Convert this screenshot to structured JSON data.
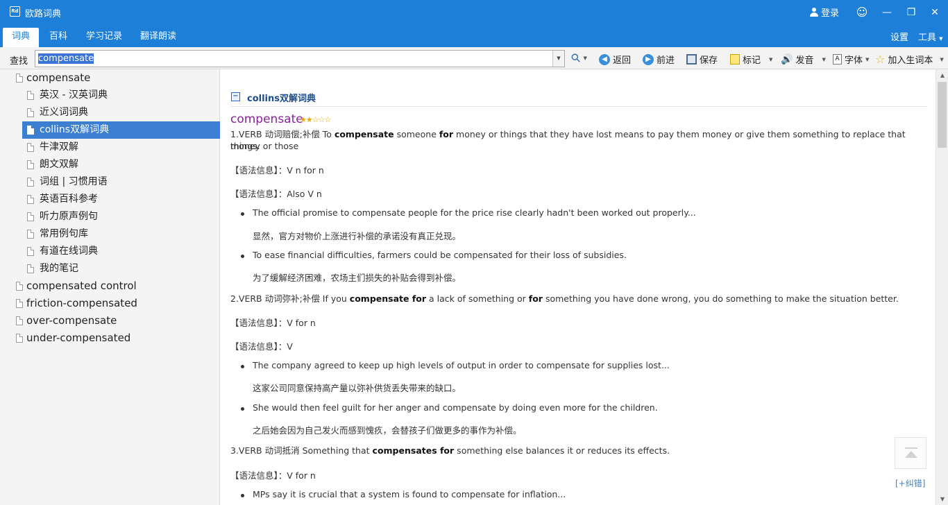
{
  "titlebar": {
    "logo_text": "Rd",
    "app_title": "欧路词典",
    "login": "登录",
    "smile_icon": "☺",
    "minimize": "—",
    "restore": "❐",
    "close": "✕"
  },
  "tabs": [
    {
      "label": "词典"
    },
    {
      "label": "百科"
    },
    {
      "label": "学习记录"
    },
    {
      "label": "翻译朗读"
    }
  ],
  "tabbar_right": {
    "settings": "设置",
    "tools": "工具"
  },
  "toolbar": {
    "search_label": "查找",
    "search_value": "compensate",
    "search_icon": "⚲",
    "back": "返回",
    "forward": "前进",
    "save": "保存",
    "mark": "标记",
    "pronounce": "发音",
    "font": "字体",
    "add_wordbook": "加入生词本"
  },
  "tree": {
    "root": "compensate",
    "children": [
      "英汉 - 汉英词典",
      "近义词词典",
      "collins双解词典",
      "牛津双解",
      "朗文双解",
      "词组 | 习惯用语",
      "英语百科参考",
      "听力原声例句",
      "常用例句库",
      "有道在线词典",
      "我的笔记"
    ],
    "selected_index": 2,
    "others": [
      "compensated control",
      "friction-compensated",
      "over-compensate",
      "under-compensated"
    ]
  },
  "content": {
    "section_title": "collins双解词典",
    "headword": "compensate",
    "stars": "★★☆☆☆",
    "senses": [
      {
        "prefix": "1.VERB 动词赔偿;补偿 To ",
        "kw1": "compensate",
        "mid1": " someone ",
        "kw2": "for",
        "rest": " money or things that they have lost means to pay them money or give them something to replace that money or those",
        "rest2": "things.",
        "grammar": [
          "【语法信息】：V n for n",
          "【语法信息】：Also V n"
        ],
        "examples": [
          {
            "en": "The official promise to compensate people for the price rise clearly hadn't been worked out properly...",
            "zh": "显然，官方对物价上涨进行补偿的承诺没有真正兑现。"
          },
          {
            "en": "To ease financial difficulties, farmers could be compensated for their loss of subsidies.",
            "zh": "为了缓解经济困难，农场主们损失的补贴会得到补偿。"
          }
        ]
      },
      {
        "prefix": "2.VERB 动词弥补;补偿 If you ",
        "kw1": "compensate for",
        "mid1": " a lack of something or ",
        "kw2": "for",
        "rest": " something you have done wrong, you do something to make the situation better.",
        "grammar": [
          "【语法信息】：V for n",
          "【语法信息】：V"
        ],
        "examples": [
          {
            "en": "The company agreed to keep up high levels of output in order to compensate for supplies lost...",
            "zh": "这家公司同意保持高产量以弥补供货丢失带来的缺口。"
          },
          {
            "en": "She would then feel guilt for her anger and compensate by doing even more for the children.",
            "zh": "之后她会因为自己发火而感到愧疚，会替孩子们做更多的事作为补偿。"
          }
        ]
      },
      {
        "prefix": "3.VERB 动词抵消 Something that ",
        "kw1": "compensates for",
        "rest": " something else balances it or reduces its effects.",
        "grammar": [
          "【语法信息】：V for n"
        ],
        "examples": [
          {
            "en": "MPs say it is crucial that a system is found to compensate for inflation..."
          }
        ]
      }
    ],
    "report_error": "[+纠错]"
  }
}
